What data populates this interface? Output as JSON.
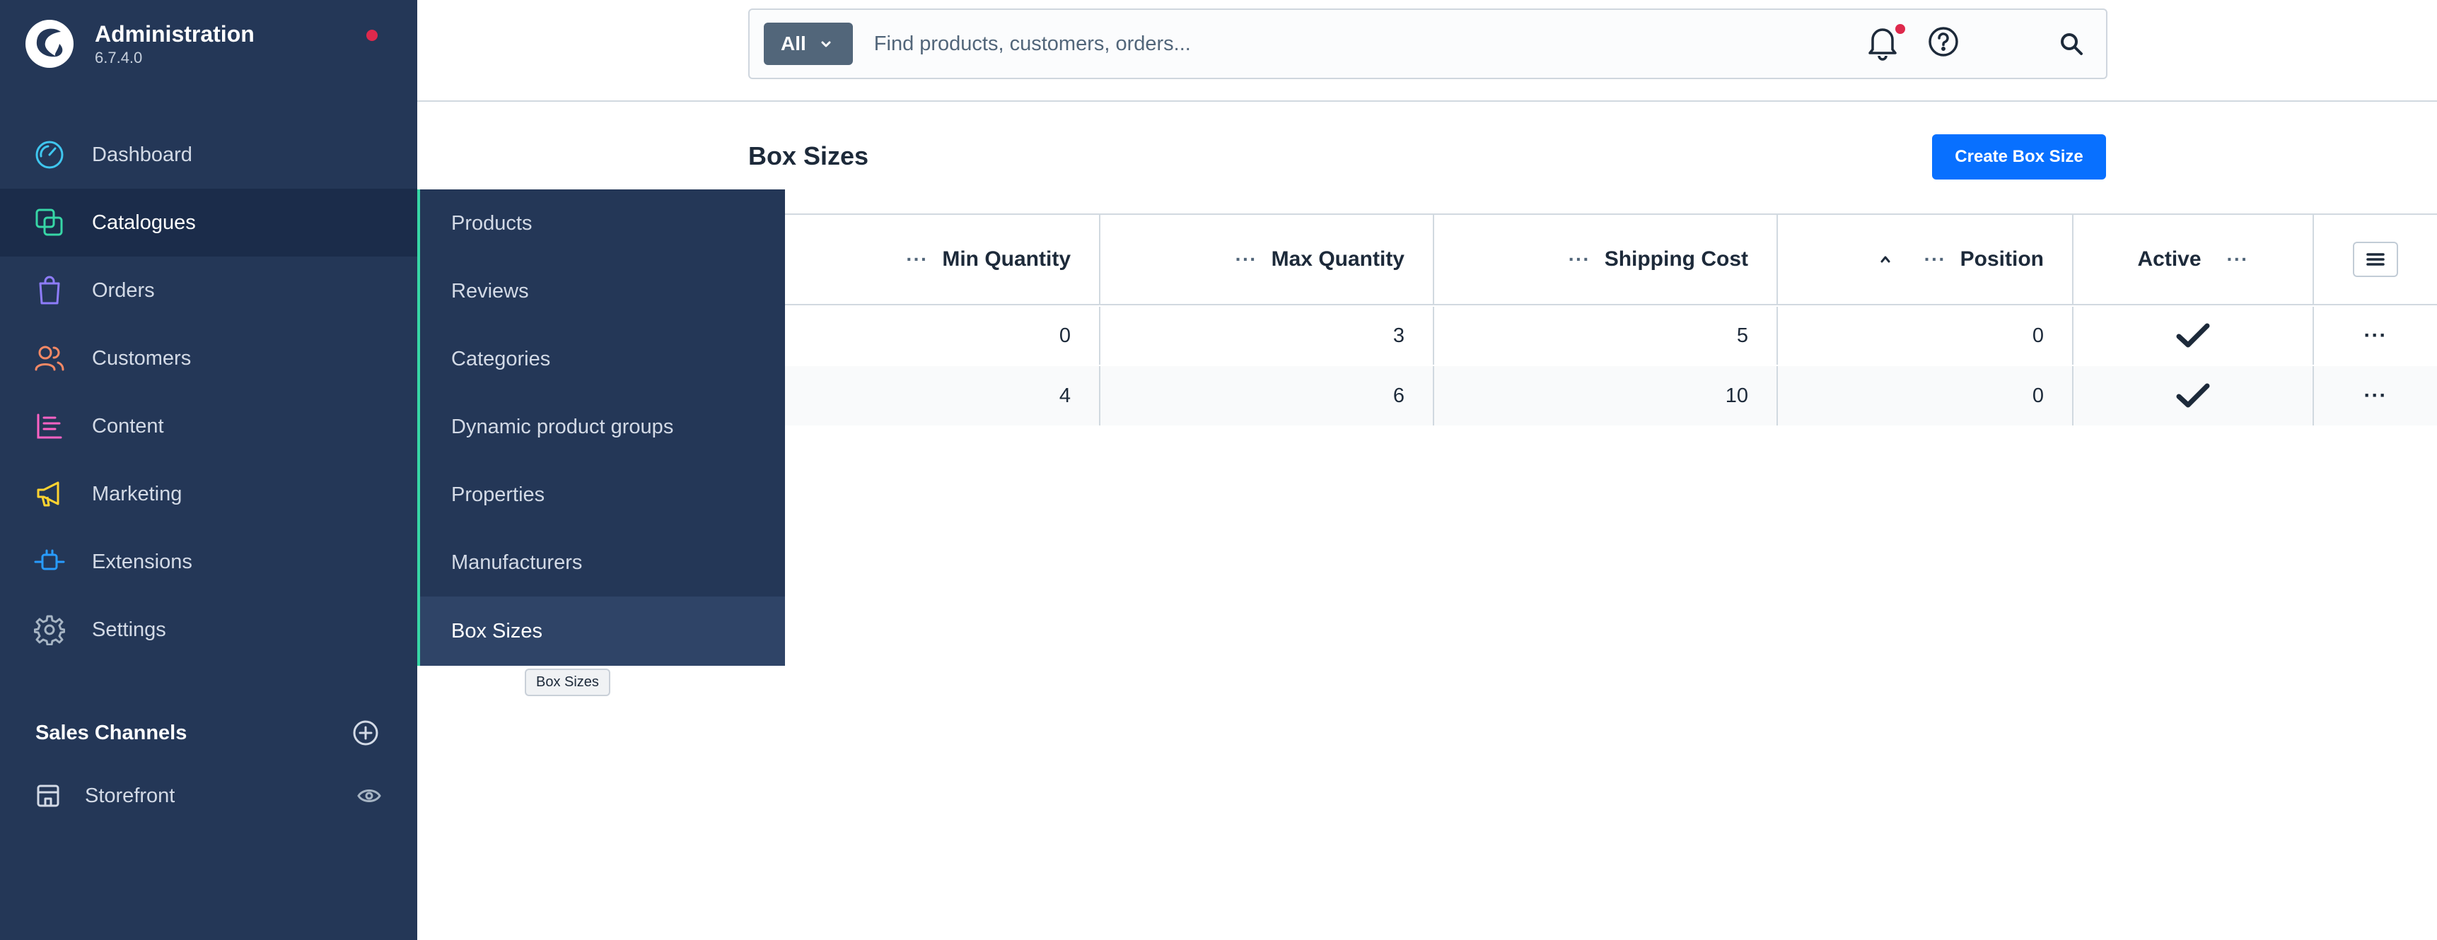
{
  "brand": {
    "title": "Administration",
    "version": "6.7.4.0",
    "logo_icon": "shopware-logo-icon"
  },
  "sidebar": {
    "items": [
      {
        "label": "Dashboard",
        "icon": "dashboard-gauge-icon",
        "color": "#3fc6ef"
      },
      {
        "label": "Catalogues",
        "icon": "catalogues-stack-icon",
        "color": "#37d6a6"
      },
      {
        "label": "Orders",
        "icon": "orders-bag-icon",
        "color": "#8e7cfb"
      },
      {
        "label": "Customers",
        "icon": "customers-users-icon",
        "color": "#f78965"
      },
      {
        "label": "Content",
        "icon": "content-list-icon",
        "color": "#ff62c4"
      },
      {
        "label": "Marketing",
        "icon": "marketing-megaphone-icon",
        "color": "#ffd330"
      },
      {
        "label": "Extensions",
        "icon": "extensions-plug-icon",
        "color": "#289cff"
      },
      {
        "label": "Settings",
        "icon": "settings-gear-icon",
        "color": "#a6b4c3"
      }
    ],
    "sales_channels": {
      "title": "Sales Channels",
      "storefront_label": "Storefront"
    }
  },
  "flyout": {
    "items": [
      "Products",
      "Reviews",
      "Categories",
      "Dynamic product groups",
      "Properties",
      "Manufacturers",
      "Box Sizes"
    ],
    "tooltip": "Box Sizes"
  },
  "search": {
    "type_label": "All",
    "placeholder": "Find products, customers, orders..."
  },
  "page": {
    "title": "Box Sizes",
    "create_label": "Create Box Size"
  },
  "grid": {
    "columns": [
      "Min Quantity",
      "Max Quantity",
      "Shipping Cost",
      "Position",
      "Active"
    ],
    "rows": [
      {
        "min": "0",
        "max": "3",
        "cost": "5",
        "position": "0",
        "active": true
      },
      {
        "min": "4",
        "max": "6",
        "cost": "10",
        "position": "0",
        "active": true
      }
    ]
  },
  "colors": {
    "accent": "#0870ff",
    "sidebar_bg": "#243757",
    "flyout_border": "#37d6a6",
    "notification_dot": "#de294c"
  }
}
